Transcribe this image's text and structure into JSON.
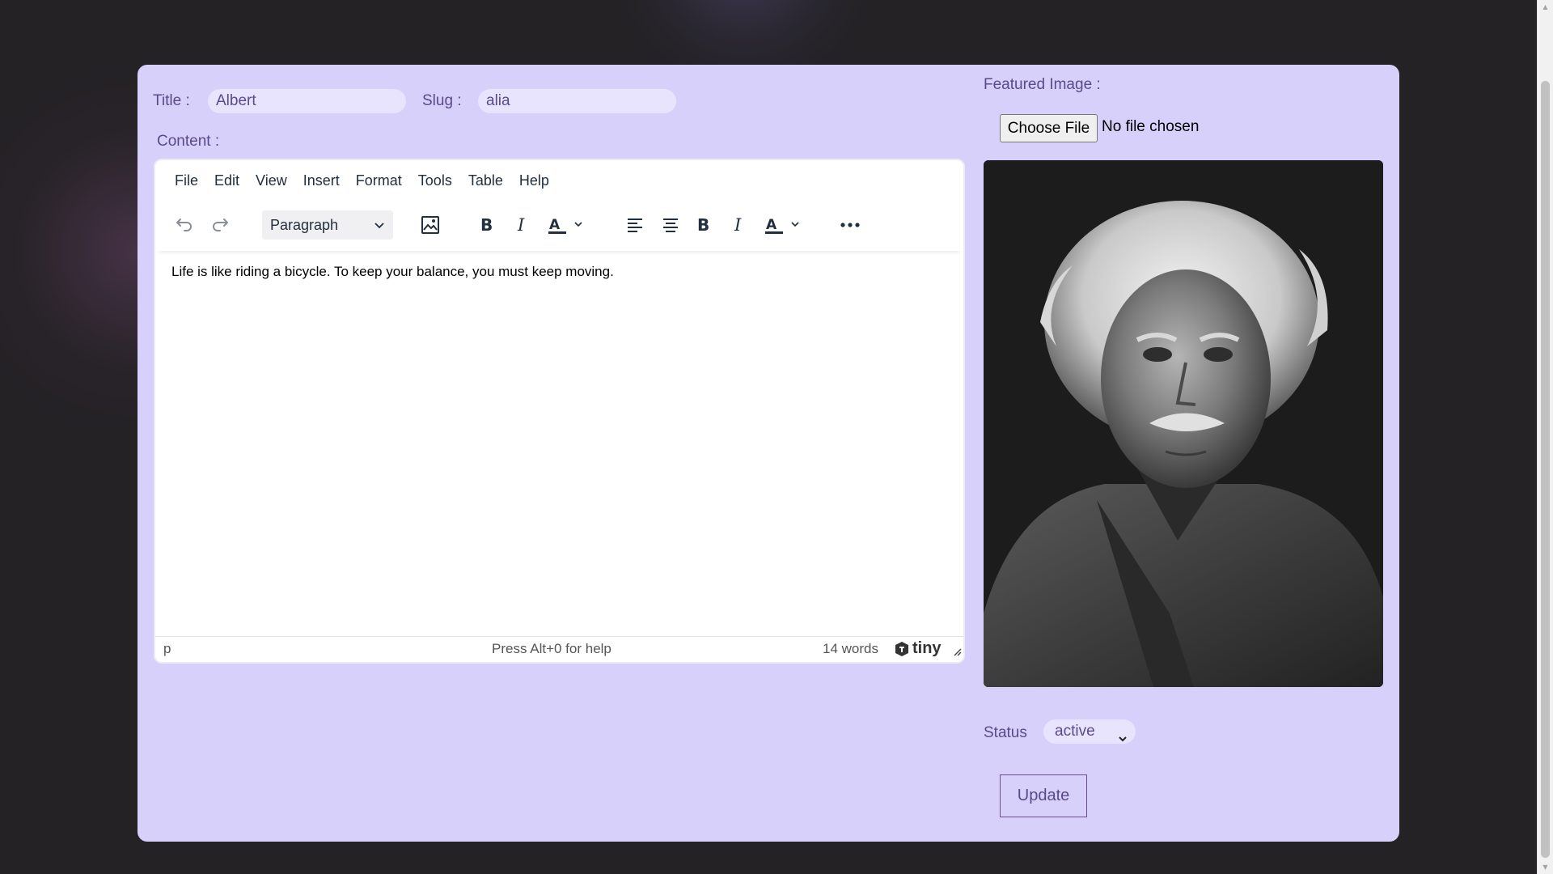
{
  "form": {
    "title_label": "Title :",
    "title_value": "Albert",
    "slug_label": "Slug :",
    "slug_value": "alia",
    "content_label": "Content :",
    "featured_label": "Featured Image :",
    "choose_file_label": "Choose File",
    "no_file_text": "No file chosen",
    "status_label": "Status",
    "status_value": "active",
    "update_label": "Update"
  },
  "editor": {
    "menu": [
      "File",
      "Edit",
      "View",
      "Insert",
      "Format",
      "Tools",
      "Table",
      "Help"
    ],
    "block_format": "Paragraph",
    "toolbar_icons": [
      "undo-icon",
      "redo-icon",
      "image-icon",
      "bold-icon",
      "italic-icon",
      "text-color-icon",
      "align-left-icon",
      "align-center-icon",
      "bold-icon",
      "italic-icon",
      "text-color-icon",
      "more-icon"
    ],
    "content_text": "Life is like riding a bicycle. To keep your balance, you must keep moving.",
    "status_path": "p",
    "help_text": "Press Alt+0 for help",
    "word_count": "14 words",
    "brand": "tiny"
  },
  "colors": {
    "page_bg": "#242225",
    "panel_bg": "#d6d0fb",
    "input_bg": "#e8e4fd",
    "label_text": "#5b4a8a"
  }
}
